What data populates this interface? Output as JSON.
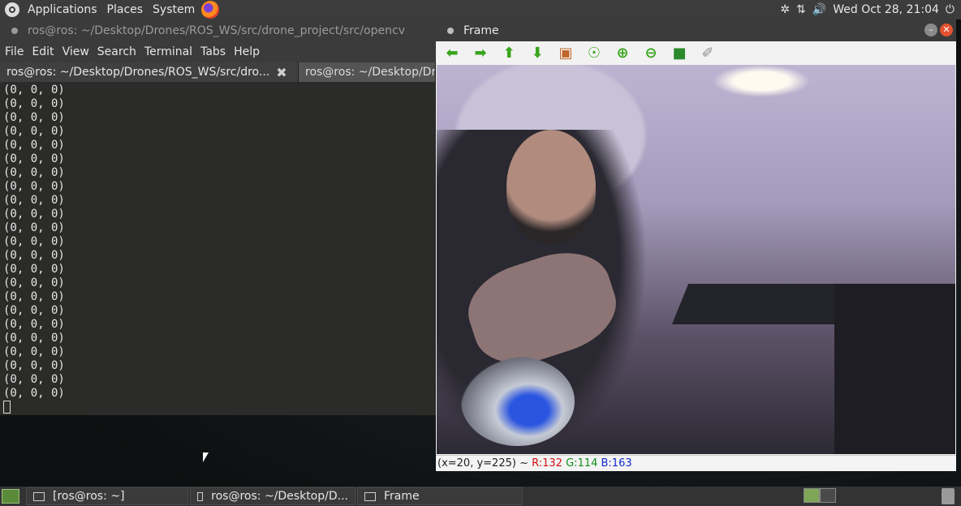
{
  "top_panel": {
    "menus": [
      "Applications",
      "Places",
      "System"
    ],
    "clock": "Wed Oct 28, 21:04",
    "tray_icons": [
      "bluetooth-icon",
      "network-icon",
      "volume-icon",
      "power-icon"
    ]
  },
  "terminal": {
    "title": "ros@ros: ~/Desktop/Drones/ROS_WS/src/drone_project/src/opencv",
    "menu": [
      "File",
      "Edit",
      "View",
      "Search",
      "Terminal",
      "Tabs",
      "Help"
    ],
    "tabs": [
      {
        "label": "ros@ros: ~/Desktop/Drones/ROS_WS/src/dro...",
        "active": true
      },
      {
        "label": "ros@ros: ~/Desktop/Dr",
        "active": false
      }
    ],
    "output_lines": [
      "(0, 0, 0)",
      "(0, 0, 0)",
      "(0, 0, 0)",
      "(0, 0, 0)",
      "(0, 0, 0)",
      "(0, 0, 0)",
      "(0, 0, 0)",
      "(0, 0, 0)",
      "(0, 0, 0)",
      "(0, 0, 0)",
      "(0, 0, 0)",
      "(0, 0, 0)",
      "(0, 0, 0)",
      "(0, 0, 0)",
      "(0, 0, 0)",
      "(0, 0, 0)",
      "(0, 0, 0)",
      "(0, 0, 0)",
      "(0, 0, 0)",
      "(0, 0, 0)",
      "(0, 0, 0)",
      "(0, 0, 0)",
      "(0, 0, 0)"
    ]
  },
  "frame": {
    "title": "Frame",
    "toolbar": [
      {
        "name": "pan-left-button",
        "icon": "arrow-left-icon",
        "glyph": "⬅",
        "color": "#3aa51e"
      },
      {
        "name": "pan-right-button",
        "icon": "arrow-right-icon",
        "glyph": "➡",
        "color": "#3aa51e"
      },
      {
        "name": "pan-up-button",
        "icon": "arrow-up-icon",
        "glyph": "⬆",
        "color": "#3aa51e"
      },
      {
        "name": "pan-down-button",
        "icon": "arrow-down-icon",
        "glyph": "⬇",
        "color": "#3aa51e"
      },
      {
        "name": "zoom-original-button",
        "icon": "image-icon",
        "glyph": "▣",
        "color": "#c0652a"
      },
      {
        "name": "zoom-fit-button",
        "icon": "zoom-fit-icon",
        "glyph": "☉",
        "color": "#3aa51e"
      },
      {
        "name": "zoom-in-button",
        "icon": "zoom-in-icon",
        "glyph": "⊕",
        "color": "#3aa51e"
      },
      {
        "name": "zoom-out-button",
        "icon": "zoom-out-icon",
        "glyph": "⊖",
        "color": "#3aa51e"
      },
      {
        "name": "save-button",
        "icon": "save-icon",
        "glyph": "■",
        "color": "#2b8a2b"
      },
      {
        "name": "properties-button",
        "icon": "brush-icon",
        "glyph": "✐",
        "color": "#8a8a8a"
      }
    ],
    "status": {
      "coords": "(x=20, y=225) ~",
      "r": "R:132",
      "g": "G:114",
      "b": "B:163"
    }
  },
  "taskbar": {
    "tasks": [
      {
        "label": "[ros@ros: ~]"
      },
      {
        "label": "ros@ros: ~/Desktop/D..."
      },
      {
        "label": "Frame"
      }
    ]
  }
}
